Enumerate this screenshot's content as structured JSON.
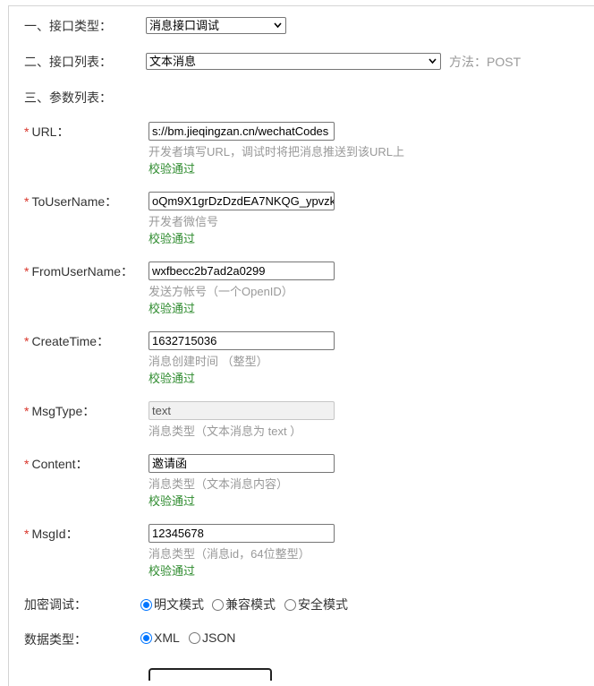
{
  "sections": {
    "interface_type_label": "一、接口类型：",
    "interface_list_label": "二、接口列表：",
    "params_label": "三、参数列表："
  },
  "interface_type_select": {
    "value": "消息接口调试"
  },
  "interface_list_select": {
    "value": "文本消息"
  },
  "method": "方法：POST",
  "required_mark": "*",
  "fields": [
    {
      "label": "URL：",
      "value": "s://bm.jieqingzan.cn/wechatCodes",
      "hint": "开发者填写URL，调试时将把消息推送到该URL上",
      "status": "校验通过",
      "disabled": false
    },
    {
      "label": "ToUserName：",
      "value": "oQm9X1grDzDzdEA7NKQG_ypvzk",
      "hint": "开发者微信号",
      "status": "校验通过",
      "disabled": false
    },
    {
      "label": "FromUserName：",
      "value": "wxfbecc2b7ad2a0299",
      "hint": "发送方帐号（一个OpenID）",
      "status": "校验通过",
      "disabled": false
    },
    {
      "label": "CreateTime：",
      "value": "1632715036",
      "hint": "消息创建时间 （整型）",
      "status": "校验通过",
      "disabled": false
    },
    {
      "label": "MsgType：",
      "value": "text",
      "hint": "消息类型（文本消息为 text ）",
      "status": "",
      "disabled": true
    },
    {
      "label": "Content：",
      "value": "邀请函",
      "hint": "消息类型（文本消息内容）",
      "status": "校验通过",
      "disabled": false
    },
    {
      "label": "MsgId：",
      "value": "12345678",
      "hint": "消息类型（消息id，64位整型）",
      "status": "校验通过",
      "disabled": false
    }
  ],
  "encryption": {
    "label": "加密调试：",
    "options": [
      "明文模式",
      "兼容模式",
      "安全模式"
    ],
    "selected": "明文模式"
  },
  "data_type": {
    "label": "数据类型：",
    "options": [
      "XML",
      "JSON"
    ],
    "selected": "XML"
  },
  "colors": {
    "required": "#d9352a",
    "success": "#2e8b2e",
    "hint": "#999999",
    "radio_accent": "#0075ff"
  }
}
